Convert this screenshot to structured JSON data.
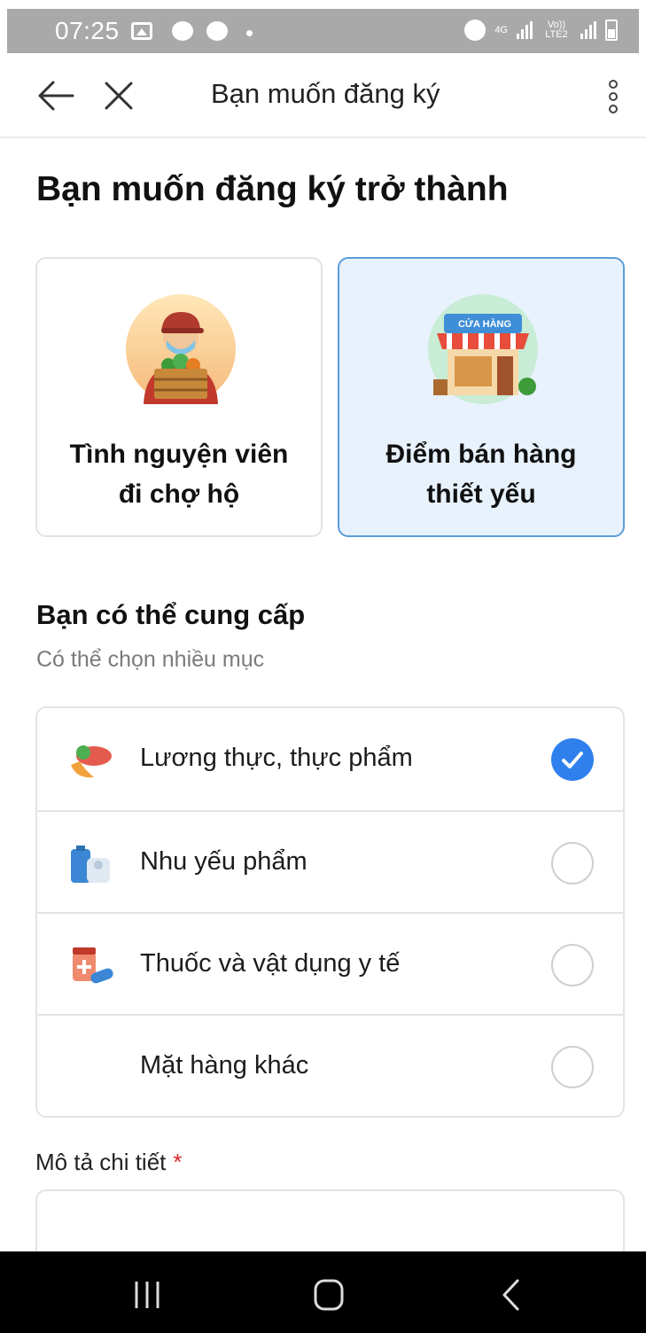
{
  "status_bar": {
    "time": "07:25",
    "network_label": "4G",
    "sim_label": "Vo)) LTE2",
    "icons": [
      "gallery-icon",
      "messenger-icon",
      "messenger-icon",
      "dot-icon",
      "alarm-icon",
      "signal-icon",
      "signal-icon",
      "battery-icon"
    ]
  },
  "app_bar": {
    "title": "Bạn muốn đăng ký",
    "icons": [
      "back-arrow-icon",
      "close-icon",
      "more-vertical-icon"
    ]
  },
  "heading": "Bạn muốn đăng ký trở thành",
  "roles": [
    {
      "label": "Tình nguyện viên đi chợ hộ",
      "icon": "volunteer-shopper-icon",
      "selected": false
    },
    {
      "label": "Điểm bán hàng thiết yếu",
      "icon": "store-icon",
      "badge": "CỬA HÀNG",
      "selected": true
    }
  ],
  "provide_section": {
    "title": "Bạn có thể cung cấp",
    "hint": "Có thể chọn nhiều mục"
  },
  "options": [
    {
      "label": "Lương thực, thực phẩm",
      "icon": "food-icon",
      "checked": true
    },
    {
      "label": "Nhu yếu phẩm",
      "icon": "essentials-icon",
      "checked": false
    },
    {
      "label": "Thuốc và vật dụng y tế",
      "icon": "medicine-icon",
      "checked": false
    },
    {
      "label": "Mặt hàng khác",
      "icon": "",
      "checked": false
    }
  ],
  "detail_field": {
    "label": "Mô tả chi tiết",
    "required_mark": "*",
    "value": ""
  },
  "colors": {
    "accent": "#2f80ed",
    "selected_card_bg": "#e8f2fc",
    "selected_card_border": "#5b9dd9",
    "required": "#d9262b",
    "status_bar_bg": "#a9a9a9"
  },
  "nav_bar": {
    "icons": [
      "recents-icon",
      "home-icon",
      "back-icon"
    ]
  }
}
